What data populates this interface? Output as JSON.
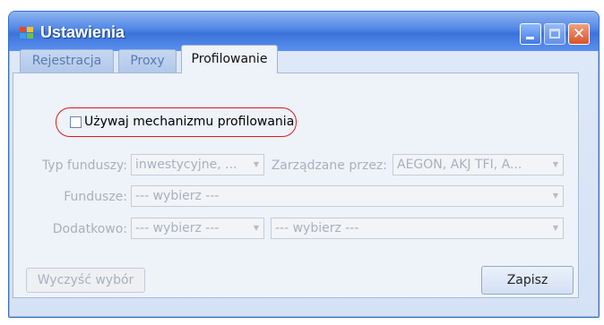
{
  "window": {
    "title": "Ustawienia"
  },
  "tabs": [
    {
      "label": "Rejestracja",
      "active": false
    },
    {
      "label": "Proxy",
      "active": false
    },
    {
      "label": "Profilowanie",
      "active": true
    }
  ],
  "checkbox": {
    "label": "Używaj mechanizmu profilowania",
    "checked": false
  },
  "form": {
    "typ_funduszy": {
      "label": "Typ funduszy:",
      "value": "inwestycyjne, ..."
    },
    "zarzadzane": {
      "label": "Zarządzane przez:",
      "value": "AEGON, AKJ TFI, A..."
    },
    "fundusze": {
      "label": "Fundusze:",
      "value": "--- wybierz ---"
    },
    "dodatkowo": {
      "label": "Dodatkowo:",
      "value1": "--- wybierz ---",
      "value2": "--- wybierz ---"
    }
  },
  "buttons": {
    "clear": "Wyczyść wybór",
    "save": "Zapisz"
  },
  "colors": {
    "titlebar": "#3b73da",
    "highlight": "#d81e1e",
    "disabled_text": "#a9b1bd"
  },
  "icons": [
    "app-icon",
    "minimize-icon",
    "maximize-icon",
    "close-icon",
    "dropdown-arrow-icon"
  ]
}
